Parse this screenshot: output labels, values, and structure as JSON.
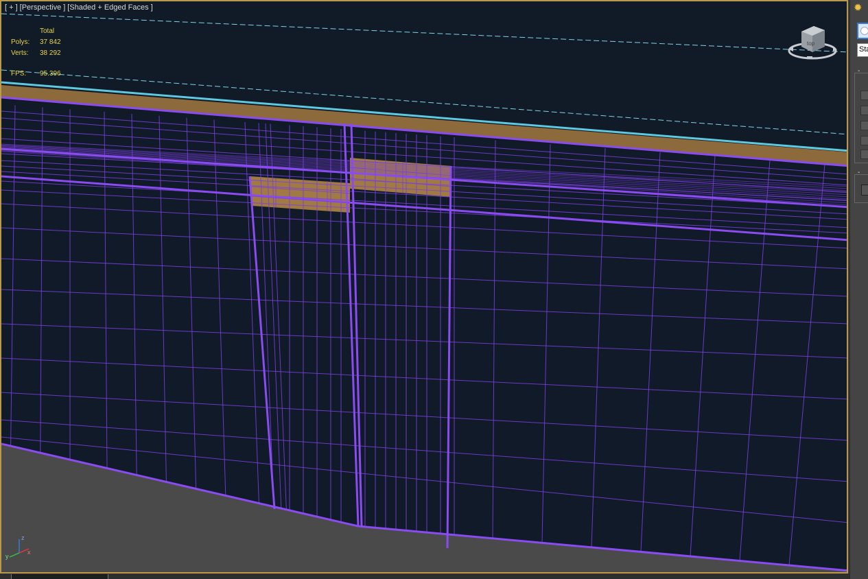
{
  "viewport": {
    "labels": [
      "[ + ]",
      "[Perspective ]",
      "[Shaded + Edged Faces ]"
    ]
  },
  "stats": {
    "total_label": "Total",
    "polys_label": "Polys:",
    "polys_value": "37 842",
    "verts_label": "Verts:",
    "verts_value": "38 292",
    "fps_label": "FPS:",
    "fps_value": "95.396"
  },
  "viewcube": {
    "face_label": "top",
    "icon": "viewcube-icon"
  },
  "axis": {
    "z": "z",
    "x": "x",
    "y": "y"
  },
  "side_panel": {
    "dropdown_value": "Sta",
    "minus_label": "-",
    "sun_icon": "sun-icon"
  },
  "colors": {
    "viewport_bg": "#111a27",
    "wire": "#7b3fe0",
    "wood": "#a07a42",
    "cyan_line": "#5fc9e0",
    "floor": "#4a4a4a",
    "border_active": "#b89a4a"
  }
}
